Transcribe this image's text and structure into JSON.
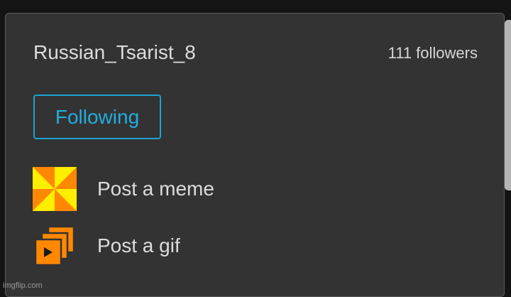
{
  "profile": {
    "username": "Russian_Tsarist_8",
    "followers": "111 followers",
    "follow_button_label": "Following"
  },
  "actions": [
    {
      "label": "Post a meme",
      "icon": "meme-icon"
    },
    {
      "label": "Post a gif",
      "icon": "gif-icon"
    }
  ],
  "watermark": "imgflip.com",
  "colors": {
    "background": "#141414",
    "card": "#333333",
    "accent": "#1aa3d1",
    "text": "#dcdcdc",
    "icon_orange": "#ff8800",
    "icon_yellow": "#ffee00"
  }
}
